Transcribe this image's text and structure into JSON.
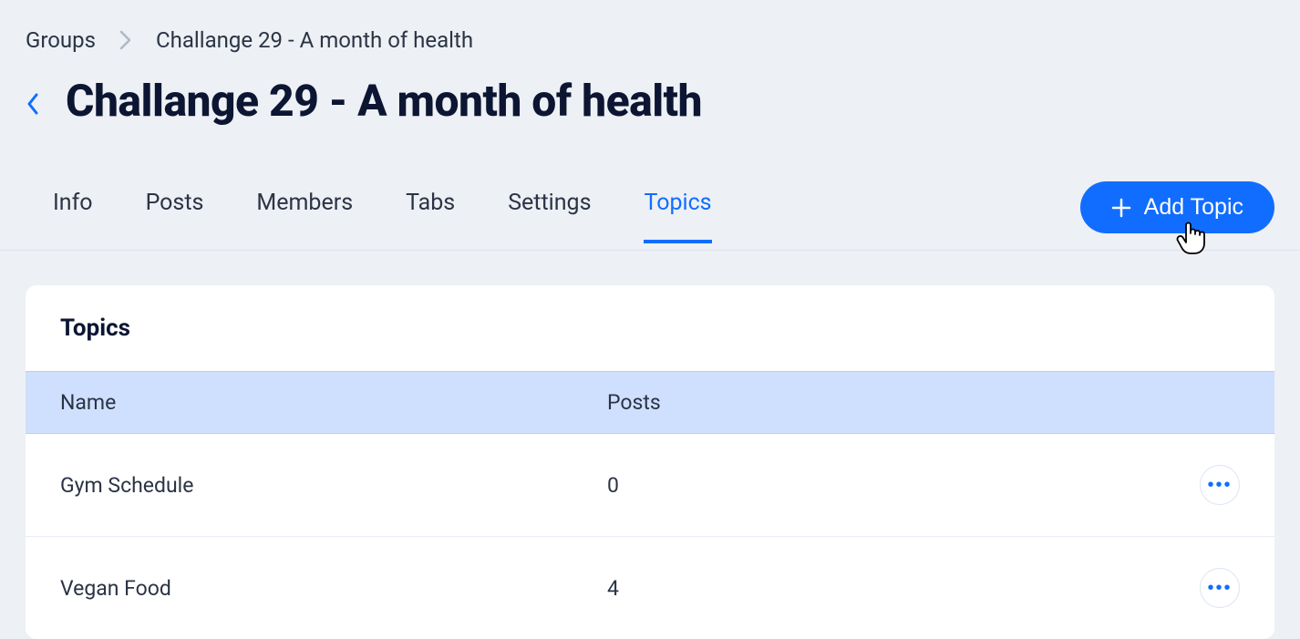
{
  "breadcrumb": {
    "parent": "Groups",
    "current": "Challange 29 - A month of health"
  },
  "page_title": "Challange 29 - A month of health",
  "tabs": [
    {
      "label": "Info",
      "active": false
    },
    {
      "label": "Posts",
      "active": false
    },
    {
      "label": "Members",
      "active": false
    },
    {
      "label": "Tabs",
      "active": false
    },
    {
      "label": "Settings",
      "active": false
    },
    {
      "label": "Topics",
      "active": true
    }
  ],
  "add_topic_label": "Add Topic",
  "panel": {
    "title": "Topics",
    "columns": {
      "name": "Name",
      "posts": "Posts"
    },
    "rows": [
      {
        "name": "Gym Schedule",
        "posts": "0"
      },
      {
        "name": "Vegan Food",
        "posts": "4"
      }
    ]
  }
}
